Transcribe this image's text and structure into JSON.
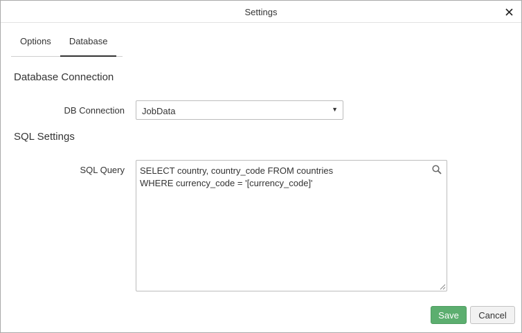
{
  "dialog": {
    "title": "Settings"
  },
  "tabs": [
    {
      "label": "Options",
      "active": false
    },
    {
      "label": "Database",
      "active": true
    }
  ],
  "database_connection": {
    "heading": "Database Connection",
    "db_label": "DB Connection",
    "db_value": "JobData"
  },
  "sql_settings": {
    "heading": "SQL Settings",
    "query_label": "SQL Query",
    "query_value": "SELECT country, country_code FROM countries\nWHERE currency_code = '[currency_code]'"
  },
  "buttons": {
    "save": "Save",
    "cancel": "Cancel"
  },
  "colors": {
    "save_button": "#5cae6f",
    "tab_underline": "#333333"
  },
  "icons": {
    "close": "close-icon",
    "search": "search-icon",
    "dropdown": "caret-down-icon"
  }
}
